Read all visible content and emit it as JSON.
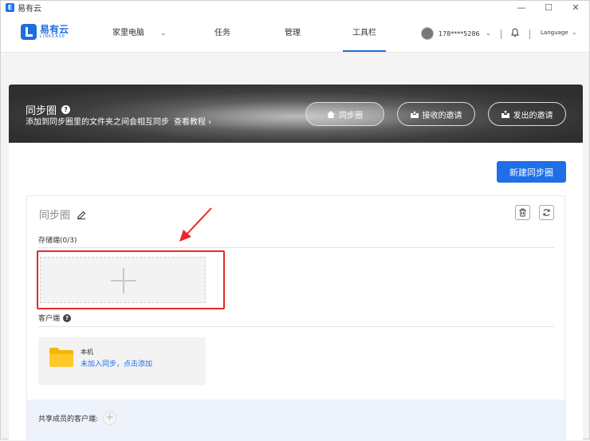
{
  "window": {
    "title": "易有云",
    "minimize": "—",
    "maximize": "☐",
    "close": "✕"
  },
  "logo": {
    "cn": "易有云",
    "en": "LINKEASE"
  },
  "nav": {
    "items": [
      {
        "label": "家里电脑"
      },
      {
        "label": "任务"
      },
      {
        "label": "管理"
      },
      {
        "label": "工具栏"
      }
    ],
    "active": "工具栏",
    "user": "178****5286",
    "language": "Language"
  },
  "banner": {
    "title": "同步圈",
    "subtitle": "添加到同步圈里的文件夹之间会相互同步",
    "tutorial_link": "查看教程 ›",
    "buttons": [
      {
        "label": "同步圈",
        "icon": "home-icon"
      },
      {
        "label": "接收的邀请",
        "icon": "inbox-icon"
      },
      {
        "label": "发出的邀请",
        "icon": "outbox-icon"
      }
    ]
  },
  "main": {
    "new_button": "新建同步圈",
    "group": {
      "name": "同步圈",
      "storage_label": "存储端(0/3)",
      "client_label": "客户端",
      "client_card": {
        "name": "本机",
        "action": "未加入同步，点击添加"
      },
      "shared_label": "共享成员的客户端:"
    }
  },
  "colors": {
    "accent": "#1e6fe8",
    "annotation": "#e8282b"
  }
}
